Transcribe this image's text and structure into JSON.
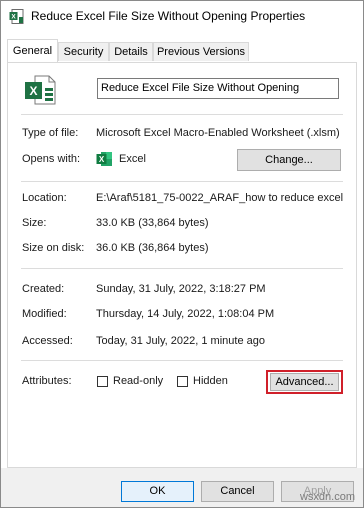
{
  "window": {
    "title": "Reduce Excel File Size Without Opening Properties"
  },
  "tabs": [
    {
      "label": "General",
      "active": true
    },
    {
      "label": "Security"
    },
    {
      "label": "Details"
    },
    {
      "label": "Previous Versions"
    }
  ],
  "general": {
    "file_name": "Reduce Excel File Size Without Opening",
    "type_label": "Type of file:",
    "type_value": "Microsoft Excel Macro-Enabled Worksheet (.xlsm)",
    "opens_label": "Opens with:",
    "opens_app": "Excel",
    "change_button": "Change...",
    "location_label": "Location:",
    "location_value": "E:\\Araf\\5181_75-0022_ARAF_how to reduce excel",
    "size_label": "Size:",
    "size_value": "33.0 KB (33,864 bytes)",
    "size_on_disk_label": "Size on disk:",
    "size_on_disk_value": "36.0 KB (36,864 bytes)",
    "created_label": "Created:",
    "created_value": "Sunday, 31 July, 2022, 3:18:27 PM",
    "modified_label": "Modified:",
    "modified_value": "Thursday, 14 July, 2022, 1:08:04 PM",
    "accessed_label": "Accessed:",
    "accessed_value": "Today, 31 July, 2022, 1 minute ago",
    "attributes_label": "Attributes:",
    "readonly_label": "Read-only",
    "readonly_checked": false,
    "hidden_label": "Hidden",
    "hidden_checked": false,
    "advanced_button": "Advanced..."
  },
  "footer": {
    "ok_button": "OK",
    "cancel_button": "Cancel",
    "apply_button": "Apply"
  },
  "watermark": "wsxdn.com",
  "colors": {
    "highlight": "#d0202a",
    "excel_green": "#1f7244"
  }
}
